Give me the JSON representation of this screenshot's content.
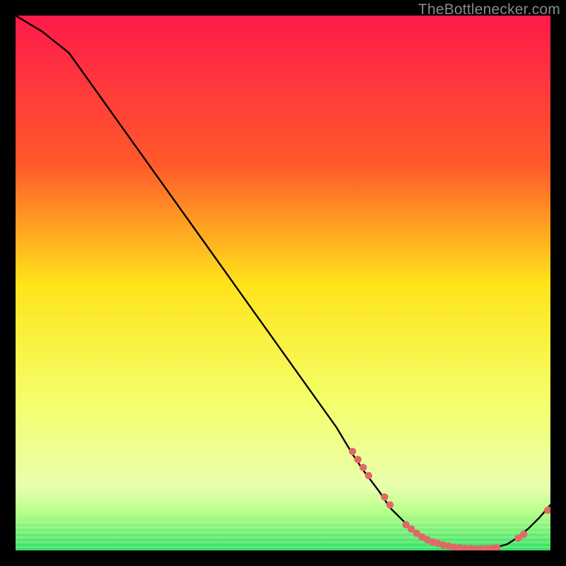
{
  "watermark": "TheBottlenecker.com",
  "chart_data": {
    "type": "line",
    "title": "",
    "xlabel": "",
    "ylabel": "",
    "xlim": [
      0,
      100
    ],
    "ylim": [
      0,
      100
    ],
    "grid": false,
    "x": [
      0,
      5,
      10,
      15,
      20,
      25,
      30,
      35,
      40,
      45,
      50,
      55,
      60,
      63,
      65,
      68,
      70,
      73,
      75,
      78,
      80,
      82,
      84,
      86,
      88,
      90,
      92,
      94,
      96,
      98,
      100
    ],
    "values": [
      100,
      97,
      93,
      86,
      79,
      72,
      65,
      58,
      51,
      44,
      37,
      30,
      23,
      18,
      15,
      11,
      8,
      5,
      3,
      1.5,
      0.8,
      0.4,
      0.2,
      0.2,
      0.3,
      0.6,
      1.2,
      2.5,
      4.2,
      6.2,
      8.5
    ],
    "cluster_points_x": [
      63,
      64,
      65,
      66,
      69,
      70,
      73,
      74,
      75,
      76,
      77,
      78,
      79,
      80,
      81,
      82,
      83,
      84,
      85,
      86,
      87,
      88,
      89,
      90,
      94,
      95,
      99.5
    ],
    "cluster_points_y": [
      18.5,
      17,
      15.5,
      14,
      10,
      8.5,
      4.8,
      4,
      3.2,
      2.5,
      2,
      1.6,
      1.3,
      1,
      0.8,
      0.6,
      0.5,
      0.4,
      0.35,
      0.3,
      0.3,
      0.35,
      0.4,
      0.5,
      2.3,
      3,
      7.5
    ]
  },
  "colors": {
    "gradient_top": "#ff1a4b",
    "gradient_mid_upper": "#ff8a1f",
    "gradient_mid": "#ffe31a",
    "gradient_lower": "#f4ff6a",
    "gradient_green1": "#b6ff8a",
    "gradient_green2": "#30e060",
    "line": "#000000",
    "dots": "#e06868"
  }
}
